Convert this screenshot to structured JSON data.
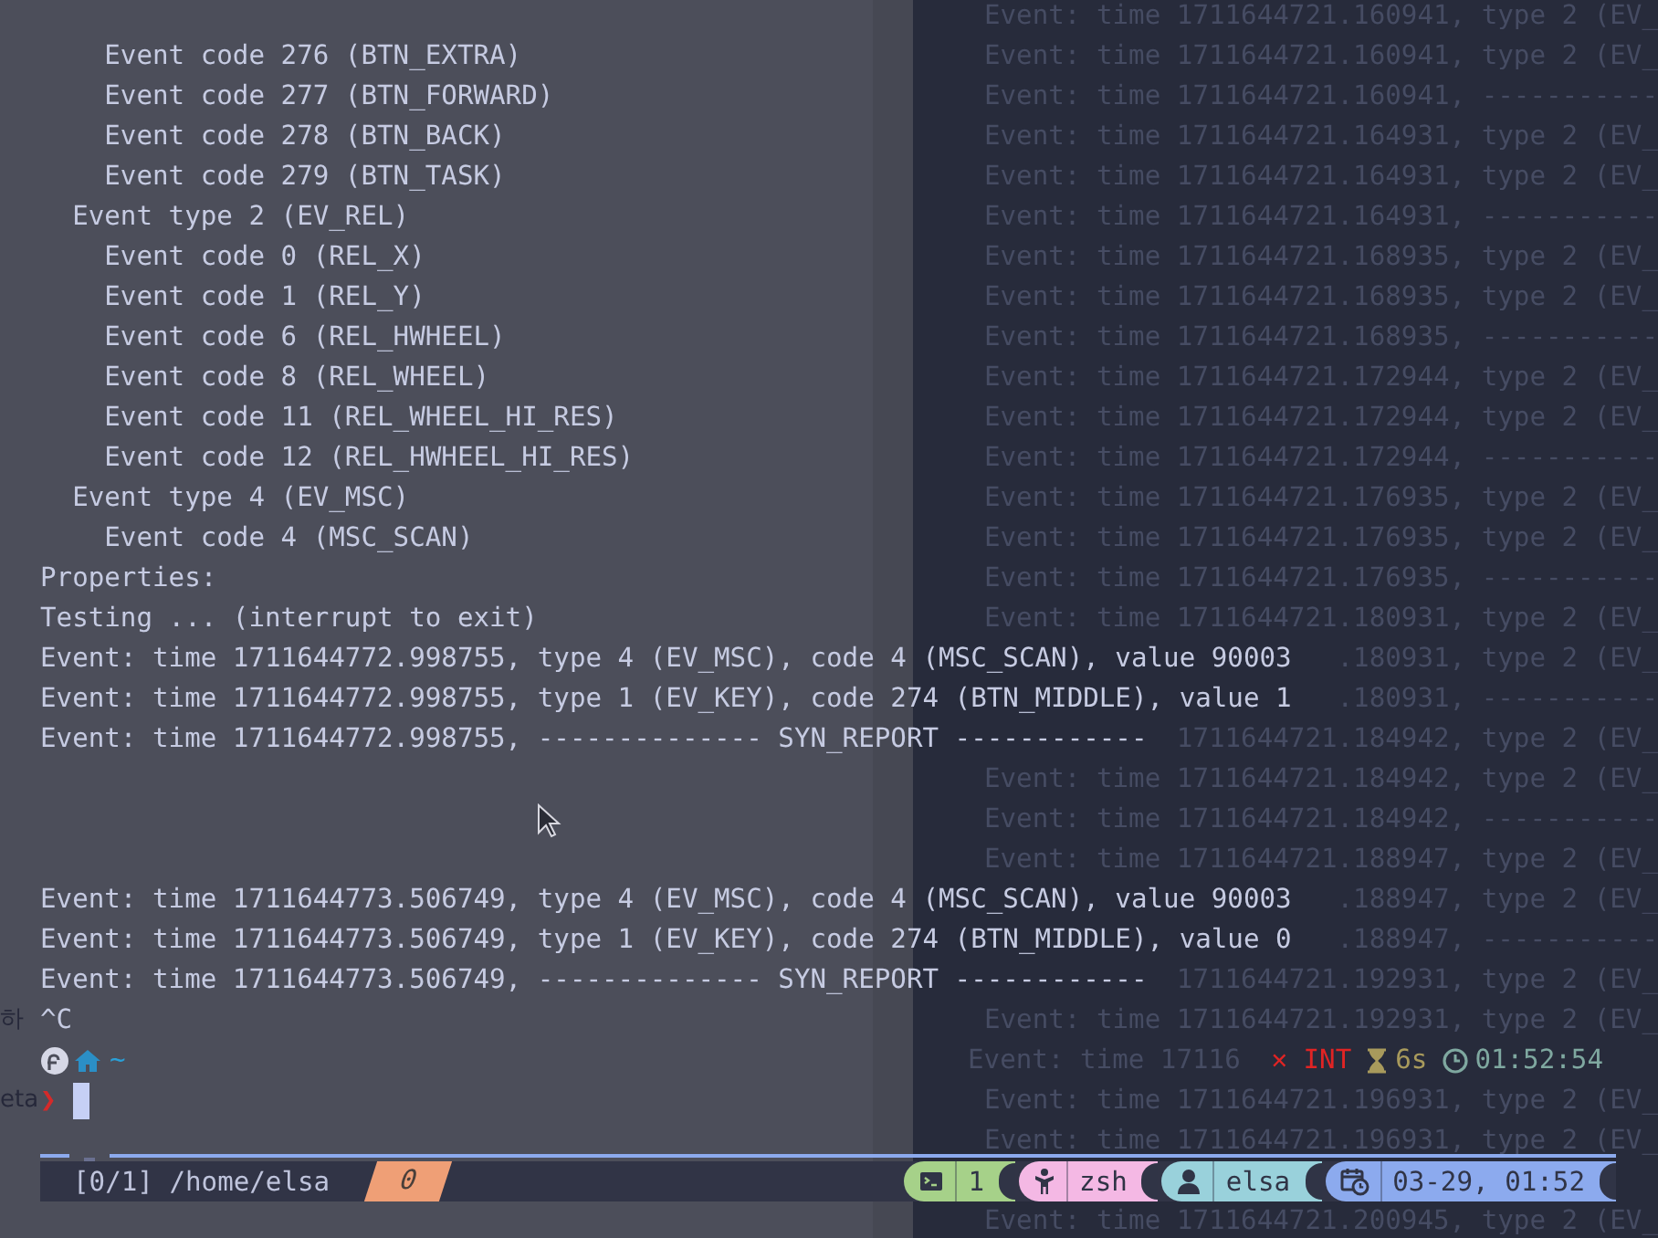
{
  "terminal": {
    "rows": [
      {
        "behind": {
          "kind": "full",
          "text": "Event: time 1711644721.160941, type 2 (EV_"
        }
      },
      {
        "kind": "output",
        "text": "    Event code 276 (BTN_EXTRA)",
        "behind": {
          "kind": "full",
          "text": "Event: time 1711644721.160941, type 2 (EV_"
        }
      },
      {
        "kind": "output",
        "text": "    Event code 277 (BTN_FORWARD)",
        "behind": {
          "kind": "full",
          "text": "Event: time 1711644721.160941, -----------"
        }
      },
      {
        "kind": "output",
        "text": "    Event code 278 (BTN_BACK)",
        "behind": {
          "kind": "full",
          "text": "Event: time 1711644721.164931, type 2 (EV_"
        }
      },
      {
        "kind": "output",
        "text": "    Event code 279 (BTN_TASK)",
        "behind": {
          "kind": "full",
          "text": "Event: time 1711644721.164931, type 2 (EV_"
        }
      },
      {
        "kind": "output",
        "text": "  Event type 2 (EV_REL)",
        "behind": {
          "kind": "full",
          "text": "Event: time 1711644721.164931, -----------"
        }
      },
      {
        "kind": "output",
        "text": "    Event code 0 (REL_X)",
        "behind": {
          "kind": "full",
          "text": "Event: time 1711644721.168935, type 2 (EV_"
        }
      },
      {
        "kind": "output",
        "text": "    Event code 1 (REL_Y)",
        "behind": {
          "kind": "full",
          "text": "Event: time 1711644721.168935, type 2 (EV_"
        }
      },
      {
        "kind": "output",
        "text": "    Event code 6 (REL_HWHEEL)",
        "behind": {
          "kind": "full",
          "text": "Event: time 1711644721.168935, -----------"
        }
      },
      {
        "kind": "output",
        "text": "    Event code 8 (REL_WHEEL)",
        "behind": {
          "kind": "full",
          "text": "Event: time 1711644721.172944, type 2 (EV_"
        }
      },
      {
        "kind": "output",
        "text": "    Event code 11 (REL_WHEEL_HI_RES)",
        "behind": {
          "kind": "full",
          "text": "Event: time 1711644721.172944, type 2 (EV_"
        }
      },
      {
        "kind": "output",
        "text": "    Event code 12 (REL_HWHEEL_HI_RES)",
        "behind": {
          "kind": "full",
          "text": "Event: time 1711644721.172944, -----------"
        }
      },
      {
        "kind": "output",
        "text": "  Event type 4 (EV_MSC)",
        "behind": {
          "kind": "full",
          "text": "Event: time 1711644721.176935, type 2 (EV_"
        }
      },
      {
        "kind": "output",
        "text": "    Event code 4 (MSC_SCAN)",
        "behind": {
          "kind": "full",
          "text": "Event: time 1711644721.176935, type 2 (EV_"
        }
      },
      {
        "kind": "output",
        "text": "Properties:",
        "behind": {
          "kind": "full",
          "text": "Event: time 1711644721.176935, -----------"
        }
      },
      {
        "kind": "output",
        "text": "Testing ... (interrupt to exit)",
        "behind": {
          "kind": "full",
          "text": "Event: time 1711644721.180931, type 2 (EV_"
        }
      },
      {
        "kind": "output",
        "text": "Event: time 1711644772.998755, type 4 (EV_MSC), code 4 (MSC_SCAN), value 90003",
        "behind": {
          "kind": "tail",
          "text": ".180931, type 2 (EV_"
        }
      },
      {
        "kind": "output",
        "text": "Event: time 1711644772.998755, type 1 (EV_KEY), code 274 (BTN_MIDDLE), value 1",
        "behind": {
          "kind": "tail",
          "text": ".180931, -----------"
        }
      },
      {
        "kind": "output",
        "text": "Event: time 1711644772.998755, -------------- SYN_REPORT ------------",
        "behind": {
          "kind": "tail",
          "text": "1711644721.184942, type 2 (EV_"
        }
      },
      {
        "behind": {
          "kind": "full",
          "text": "Event: time 1711644721.184942, type 2 (EV_"
        }
      },
      {
        "behind": {
          "kind": "full",
          "text": "Event: time 1711644721.184942, -----------"
        }
      },
      {
        "behind": {
          "kind": "full",
          "text": "Event: time 1711644721.188947, type 2 (EV_"
        }
      },
      {
        "kind": "output",
        "text": "Event: time 1711644773.506749, type 4 (EV_MSC), code 4 (MSC_SCAN), value 90003",
        "behind": {
          "kind": "tail",
          "text": ".188947, type 2 (EV_"
        }
      },
      {
        "kind": "output",
        "text": "Event: time 1711644773.506749, type 1 (EV_KEY), code 274 (BTN_MIDDLE), value 0",
        "behind": {
          "kind": "tail",
          "text": ".188947, -----------"
        }
      },
      {
        "kind": "output",
        "text": "Event: time 1711644773.506749, -------------- SYN_REPORT ------------",
        "behind": {
          "kind": "tail",
          "text": "1711644721.192931, type 2 (EV_"
        }
      },
      {
        "kind": "output",
        "text": "^C",
        "edge": "하",
        "behind": {
          "kind": "full",
          "text": "Event: time 1711644721.192931, type 2 (EV_"
        }
      },
      {
        "kind": "prompt",
        "path": "~",
        "error": "✕ INT",
        "duration": "6s",
        "clock": "01:52:54",
        "behind": {
          "kind": "head",
          "text": "Event: time 17116"
        }
      },
      {
        "kind": "input",
        "symbol": "❯",
        "edge": "eta",
        "behind": {
          "kind": "full",
          "text": "Event: time 1711644721.196931, type 2 (EV_"
        }
      },
      {
        "kind": "rule",
        "behind": {
          "kind": "full",
          "text": "Event: time 1711644721.196931, type 2 (EV_"
        }
      }
    ]
  },
  "status_bar": {
    "session": "[0/1] /home/elsa",
    "windows": [
      {
        "label": "0",
        "selected": true
      }
    ],
    "segments": [
      {
        "kind": "window",
        "text": "1",
        "color": "#a6d189"
      },
      {
        "kind": "program",
        "text": "zsh",
        "color": "#f4b8e4"
      },
      {
        "kind": "user",
        "text": "elsa",
        "color": "#99d1db"
      },
      {
        "kind": "datetime",
        "text": "03-29, 01:52",
        "color": "#8caaee"
      }
    ]
  },
  "rows_below": [
    {
      "behind": {
        "kind": "full",
        "text": "Event: time 1711644721.200945, type 2 (EV_"
      }
    }
  ]
}
